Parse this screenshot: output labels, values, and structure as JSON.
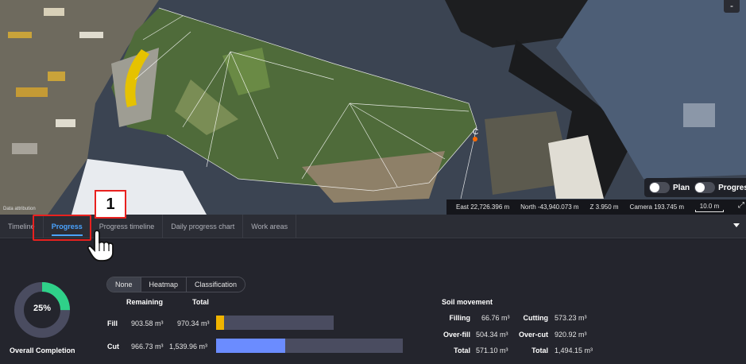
{
  "map": {
    "zoom_symbol": "-",
    "attribution": "Data attribution",
    "marker_label": "C",
    "toggles": [
      {
        "label": "Plan",
        "on": false
      },
      {
        "label": "Progress",
        "on": false
      }
    ],
    "status": {
      "east": "East 22,726.396 m",
      "north": "North -43,940.073 m",
      "z": "Z 3.950 m",
      "camera": "Camera 193.745 m",
      "scale": "10.0 m"
    },
    "colors": {
      "fill_accent": "#e6c200",
      "marker": "#ff6a00"
    }
  },
  "tabs": [
    {
      "label": "Timeline",
      "active": false
    },
    {
      "label": "Progress",
      "active": true
    },
    {
      "label": "Progress timeline",
      "active": false
    },
    {
      "label": "Daily progress chart",
      "active": false
    },
    {
      "label": "Work areas",
      "active": false
    }
  ],
  "annotation": {
    "number": "1"
  },
  "overall": {
    "percent": "25%",
    "fraction": 0.25,
    "label": "Overall Completion",
    "color": "#2fd189",
    "track_color": "#4a4c60"
  },
  "modes": [
    {
      "label": "None",
      "active": true
    },
    {
      "label": "Heatmap",
      "active": false
    },
    {
      "label": "Classification",
      "active": false
    }
  ],
  "volumes": {
    "headers": {
      "remaining": "Remaining",
      "total": "Total"
    },
    "rows": [
      {
        "label": "Fill",
        "remaining": "903.58 m³",
        "total": "970.34 m³",
        "progress": 0.07,
        "color": "#f0b400"
      },
      {
        "label": "Cut",
        "remaining": "966.73 m³",
        "total": "1,539.96 m³",
        "progress": 0.37,
        "color": "#6b8cff"
      }
    ]
  },
  "soil": {
    "title": "Soil movement",
    "left": [
      {
        "label": "Filling",
        "value": "66.76 m³"
      },
      {
        "label": "Over-fill",
        "value": "504.34 m³"
      },
      {
        "label": "Total",
        "value": "571.10 m³"
      }
    ],
    "right": [
      {
        "label": "Cutting",
        "value": "573.23 m³"
      },
      {
        "label": "Over-cut",
        "value": "920.92 m³"
      },
      {
        "label": "Total",
        "value": "1,494.15 m³"
      }
    ]
  }
}
